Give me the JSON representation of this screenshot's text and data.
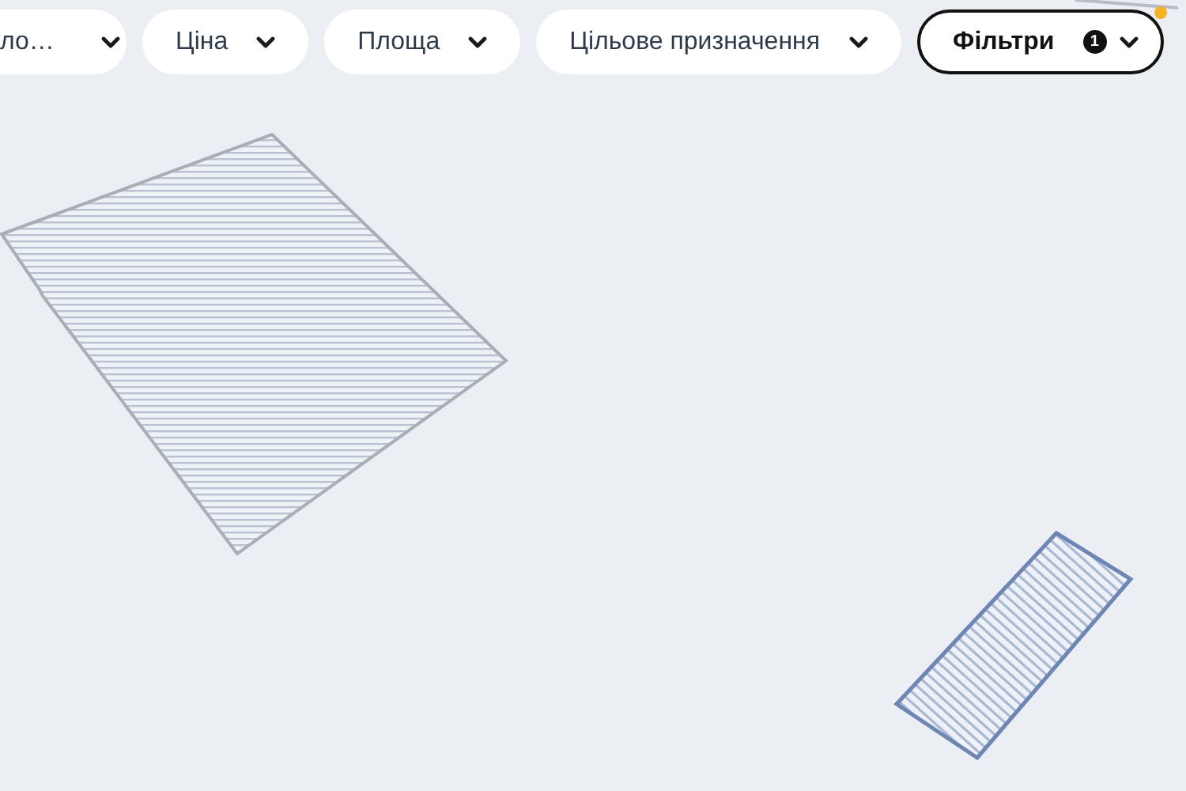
{
  "filters": [
    {
      "label": "ло…",
      "active": false
    },
    {
      "label": "Ціна",
      "active": false
    },
    {
      "label": "Площа",
      "active": false
    },
    {
      "label": "Цільове призначення",
      "active": false
    },
    {
      "label": "Фільтри",
      "active": true,
      "badge": "1"
    }
  ],
  "map": {
    "parcels": [
      {
        "selected": false
      },
      {
        "selected": true
      }
    ]
  }
}
